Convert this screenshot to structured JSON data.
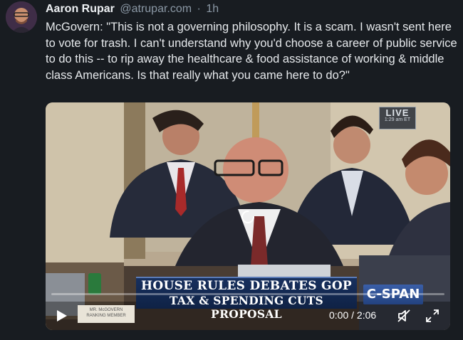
{
  "post": {
    "author": "Aaron Rupar",
    "handle": "@atrupar.com",
    "separator": "·",
    "time": "1h",
    "text": "McGovern: \"This is not a governing philosophy. It is a scam. I wasn't sent here to vote for trash. I can't understand why you'd choose a career of public service to do this -- to rip away the healthcare & food assistance of working & middle class Americans. Is that really what you came here to do?\""
  },
  "video": {
    "live_badge": "LIVE",
    "live_time": "1:29 am ET",
    "chyron_line1": "HOUSE RULES DEBATES GOP",
    "chyron_line2": "TAX & SPENDING CUTS PROPOSAL",
    "network": "C-SPAN",
    "nameplate_line1": "MR. McGOVERN",
    "nameplate_line2": "RANKING MEMBER",
    "timecode": "0:00 / 2:06",
    "progress": 0
  },
  "icons": {
    "play": "play-icon",
    "mute": "volume-muted-icon",
    "fullscreen": "fullscreen-icon",
    "spinner": "loading-spinner-icon"
  },
  "colors": {
    "background": "#181c21",
    "chyron": "#18305e",
    "cspan": "#2f55a0"
  }
}
